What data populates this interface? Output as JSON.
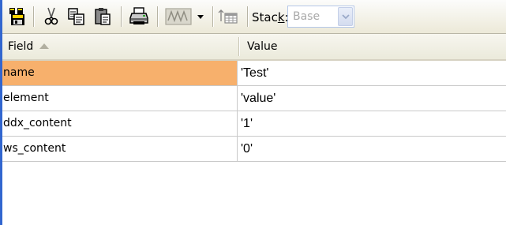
{
  "toolbar": {
    "buttons": [
      {
        "icon": "save-all-icon"
      },
      {
        "icon": "cut-icon"
      },
      {
        "icon": "copy-icon"
      },
      {
        "icon": "paste-icon"
      },
      {
        "icon": "print-icon"
      },
      {
        "icon": "waveform-icon"
      },
      {
        "icon": "dropdown-arrow-icon"
      },
      {
        "icon": "table-icon"
      }
    ],
    "stack_label_pre": "Stac",
    "stack_label_key": "k",
    "stack_label_post": ":",
    "stack_value": "Base"
  },
  "grid": {
    "headers": {
      "field": "Field",
      "value": "Value"
    },
    "rows": [
      {
        "field": "name",
        "value": "'Test'",
        "selected": true
      },
      {
        "field": "element",
        "value": "'value'"
      },
      {
        "field": "ddx_content",
        "value": "'1'"
      },
      {
        "field": "ws_content",
        "value": "'0'"
      }
    ]
  },
  "colors": {
    "selection": "#f7b06c",
    "accent_bar": "#3266cf"
  }
}
